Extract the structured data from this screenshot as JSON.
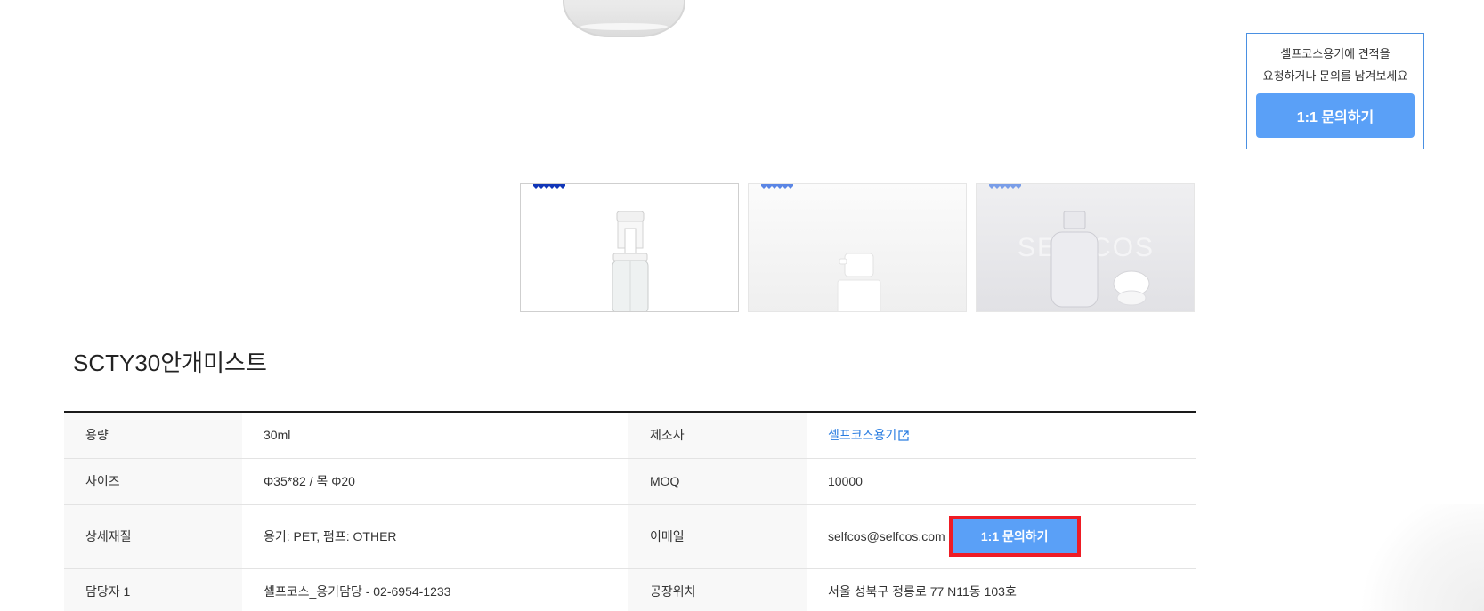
{
  "quote_box": {
    "line1": "셀프코스용기에 견적을",
    "line2": "요청하거나 문의를 남겨보세요",
    "button_label": "1:1 문의하기"
  },
  "thumbnails": [
    {
      "icon": "bottle-white-background"
    },
    {
      "icon": "spray-nozzle-closeup"
    },
    {
      "icon": "bottle-with-cap-watermark",
      "watermark": "SELFCOS"
    }
  ],
  "product": {
    "title": "SCTY30안개미스트"
  },
  "info_table": {
    "rows": [
      {
        "label1": "용량",
        "value1": "30ml",
        "label2": "제조사",
        "value2": "셀프코스용기"
      },
      {
        "label1": "사이즈",
        "value1": "Φ35*82 / 목 Φ20",
        "label2": "MOQ",
        "value2": "10000"
      },
      {
        "label1": "상세재질",
        "value1": "용기: PET, 펌프: OTHER",
        "label2": "이메일",
        "value2": "selfcos@selfcos.com"
      },
      {
        "label1": "담당자 1",
        "value1": "셀프코스_용기담당 - 02-6954-1233",
        "label2": "공장위치",
        "value2": "서울 성북구 정릉로 77 N11동 103호"
      }
    ],
    "inquiry_button_label": "1:1 문의하기"
  },
  "colors": {
    "accent_blue": "#5aa0f7",
    "link_blue": "#2a7de1",
    "highlight_red": "#ee1c25"
  }
}
